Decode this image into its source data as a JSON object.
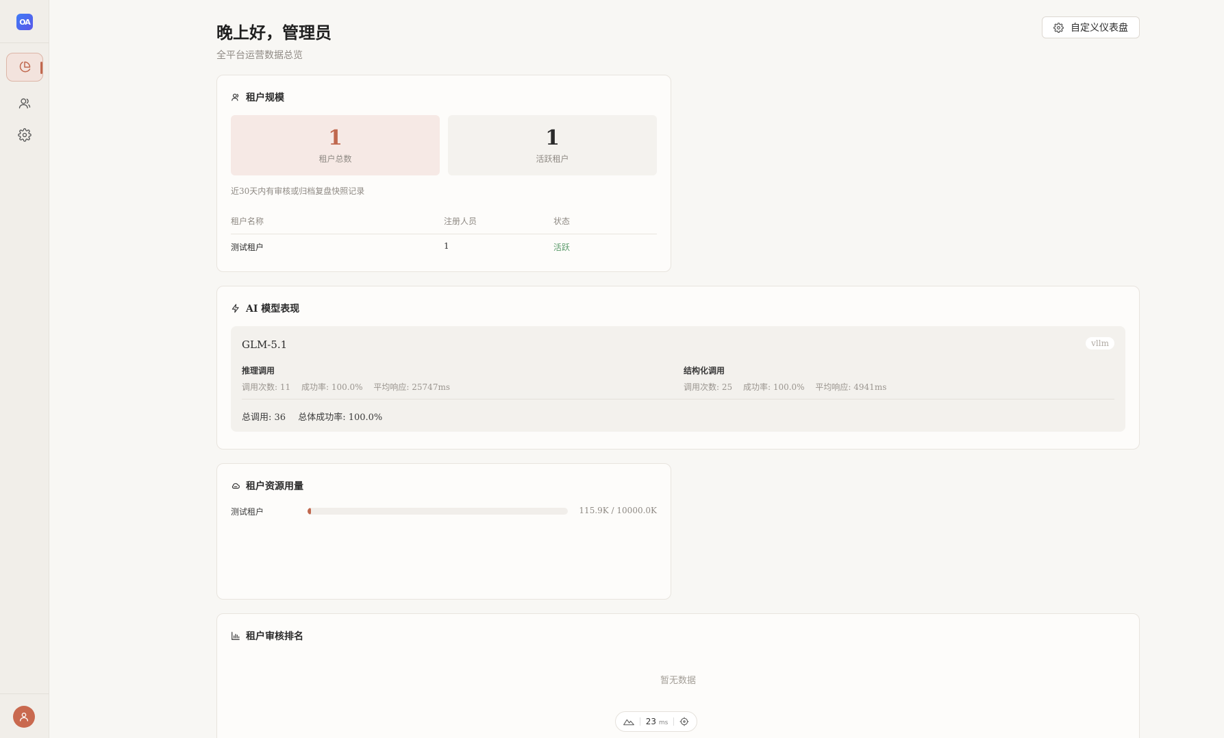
{
  "sidebar": {
    "logo_text": "OA",
    "items": [
      {
        "name": "dashboard",
        "icon": "pie-chart-icon",
        "active": true
      },
      {
        "name": "tenants",
        "icon": "users-icon",
        "active": false
      },
      {
        "name": "settings",
        "icon": "gear-icon",
        "active": false
      }
    ],
    "avatar_icon": "user-icon"
  },
  "header": {
    "title": "晚上好，管理员",
    "subtitle": "全平台运营数据总览",
    "customize_label": "自定义仪表盘"
  },
  "tenant_scale": {
    "title": "租户规模",
    "total_value": "1",
    "total_label": "租户总数",
    "active_value": "1",
    "active_label": "活跃租户",
    "note": "近30天内有审核或归档复盘快照记录",
    "columns": [
      "租户名称",
      "注册人员",
      "状态"
    ],
    "rows": [
      {
        "name": "测试租户",
        "users": "1",
        "status": "活跃"
      }
    ]
  },
  "ai_models": {
    "title": "AI 模型表现",
    "model": {
      "name": "GLM-5.1",
      "provider": "vllm",
      "inference": {
        "title": "推理调用",
        "calls": "调用次数: 11",
        "success": "成功率: 100.0%",
        "latency": "平均响应: 25747ms"
      },
      "structured": {
        "title": "结构化调用",
        "calls": "调用次数: 25",
        "success": "成功率: 100.0%",
        "latency": "平均响应: 4941ms"
      },
      "total_calls": "总调用: 36",
      "total_success": "总体成功率: 100.0%"
    }
  },
  "resource_usage": {
    "title": "租户资源用量",
    "rows": [
      {
        "name": "测试租户",
        "value": "115.9K / 10000.0K",
        "fraction": 0.0116
      }
    ]
  },
  "review_ranking": {
    "title": "租户审核排名",
    "empty": "暂无数据"
  },
  "perf": {
    "value": "23",
    "unit": "ms"
  },
  "colors": {
    "accent": "#c0684e",
    "success": "#5a9a6a",
    "stat_total_bg": "#f6e9e5",
    "stat_active_bg": "#f4f2ee"
  }
}
